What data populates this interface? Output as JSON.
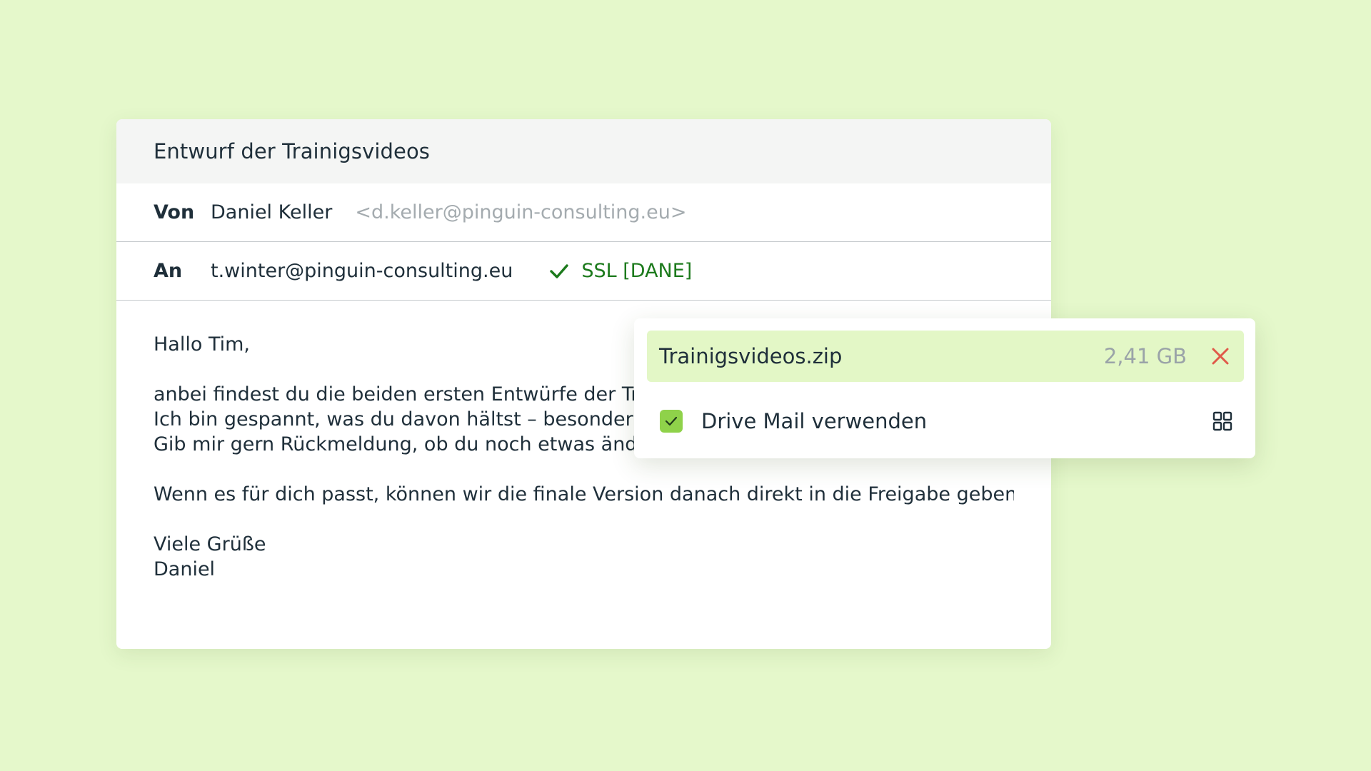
{
  "colors": {
    "background": "#e5f8cb",
    "ssl_green": "#1c7a1c",
    "attachment_highlight": "#e3f7c6",
    "checkbox_green": "#8fd24a",
    "remove_red": "#e05a4a"
  },
  "mail": {
    "subject": "Entwurf der Trainigsvideos",
    "from": {
      "label": "Von",
      "name": "Daniel Keller",
      "email": "<d.keller@pinguin-consulting.eu>"
    },
    "to": {
      "label": "An",
      "email": "t.winter@pinguin-consulting.eu",
      "ssl_status": "SSL [DANE]",
      "ssl_icon": "check-icon"
    },
    "body": {
      "greeting": "Hallo Tim,",
      "paragraph1": [
        "anbei findest du die beiden ersten Entwürfe der Traini",
        "Ich bin gespannt, was du davon hältst – besonders im",
        "Gib mir gern Rückmeldung, ob du noch etwas ändern w"
      ],
      "paragraph2": "Wenn es für dich passt, können wir die finale Version danach direkt in die Freigabe geben.",
      "closing": "Viele Grüße",
      "signature": "Daniel"
    }
  },
  "attachment": {
    "file_name": "Trainigsvideos.zip",
    "file_size": "2,41 GB",
    "remove_icon": "close-icon",
    "drive_mail_label": "Drive Mail verwenden",
    "drive_mail_checked": true,
    "grid_icon": "grid-icon"
  }
}
